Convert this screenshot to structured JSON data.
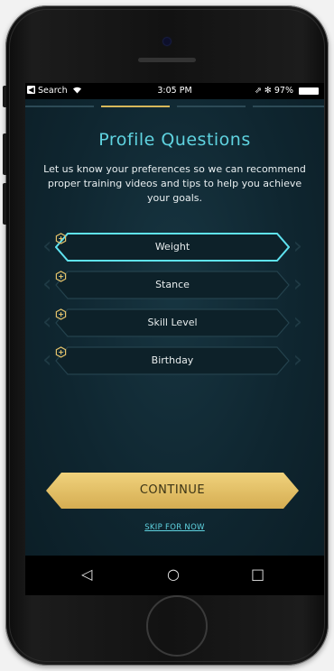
{
  "status_bar": {
    "back_app": "Search",
    "time": "3:05 PM",
    "signal_text": "⇗ ✻ 97%"
  },
  "header": {
    "title": "Profile Questions",
    "subtitle": "Let us know your preferences so we can recommend proper training videos and tips to help you achieve your goals."
  },
  "progress": {
    "total_steps": 4,
    "active_step": 2
  },
  "fields": [
    {
      "label": "Weight",
      "selected": true
    },
    {
      "label": "Stance",
      "selected": false
    },
    {
      "label": "Skill Level",
      "selected": false
    },
    {
      "label": "Birthday",
      "selected": false
    }
  ],
  "actions": {
    "continue_label": "CONTINUE",
    "skip_label": "SKIP FOR NOW"
  },
  "nav_bar": {
    "back_glyph": "◁",
    "home_glyph": "○",
    "recents_glyph": "□"
  },
  "colors": {
    "accent_cyan": "#5fd3e0",
    "accent_gold": "#e2c16a",
    "background": "#0f2630"
  }
}
